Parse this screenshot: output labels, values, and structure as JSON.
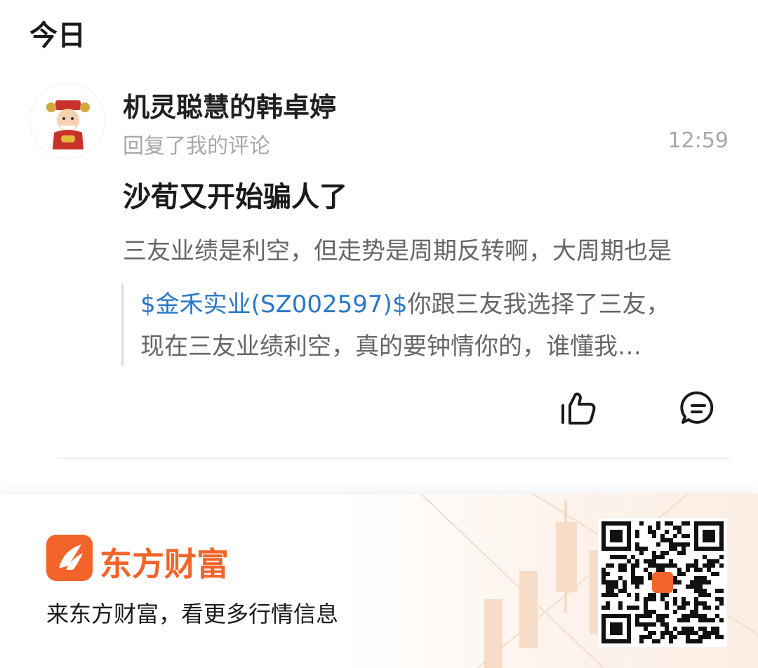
{
  "section": {
    "title": "今日"
  },
  "notification": {
    "username": "机灵聪慧的韩卓婷",
    "action": "回复了我的评论",
    "time": "12:59",
    "reply": "沙荀又开始骗人了",
    "preview": "三友业绩是利空，但走势是周期反转啊，大周期也是",
    "quote": {
      "stock": "$金禾实业(SZ002597)$",
      "line1_rest": "你跟三友我选择了三友，",
      "line2": "现在三友业绩利空，真的要钟情你的，谁懂我…"
    },
    "icons": {
      "like": "thumbs-up-icon",
      "comment": "comment-icon"
    }
  },
  "promo": {
    "brand": "东方财富",
    "slogan": "来东方财富，看更多行情信息",
    "brand_color": "#f2642a"
  },
  "colors": {
    "link": "#2a78c8",
    "muted": "#a8a8a8",
    "body": "#666666"
  }
}
